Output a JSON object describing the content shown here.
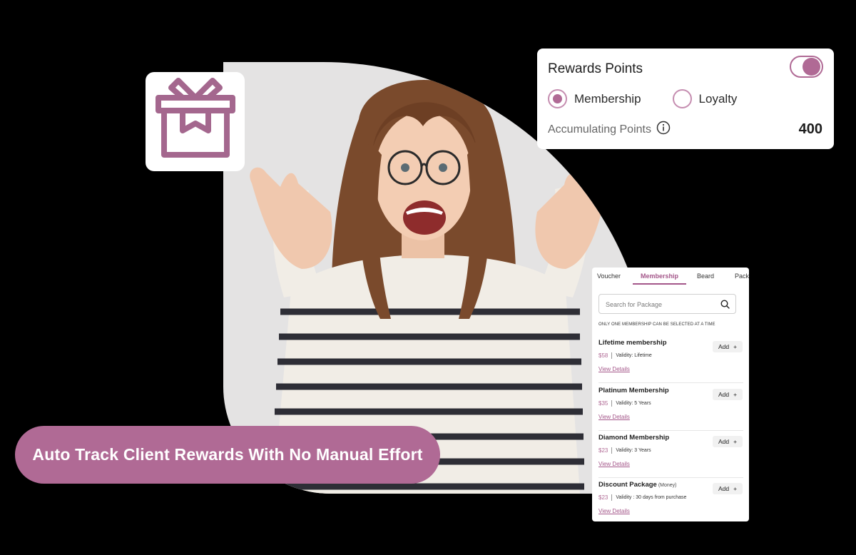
{
  "rewards": {
    "title": "Rewards Points",
    "toggle_on": true,
    "options": [
      {
        "label": "Membership",
        "selected": true
      },
      {
        "label": "Loyalty",
        "selected": false
      }
    ],
    "accumulating_label": "Accumulating Points",
    "points": "400"
  },
  "panel": {
    "tabs": [
      "Voucher",
      "Membership",
      "Beard",
      "Pack"
    ],
    "active_tab": "Membership",
    "search_placeholder": "Search for Package",
    "notice": "ONLY ONE MEMBERSHIP CAN BE SELECTED AT A TIME",
    "items": [
      {
        "name": "Lifetime membership",
        "note": "",
        "price": "$58",
        "validity": "Validity: Lifetime",
        "view": "View Details",
        "add": "Add"
      },
      {
        "name": "Platinum Membership",
        "note": "",
        "price": "$35",
        "validity": "Validity: 5 Years",
        "view": "View Details",
        "add": "Add"
      },
      {
        "name": "Diamond Membership",
        "note": "",
        "price": "$23",
        "validity": "Validity: 3 Years",
        "view": "View Details",
        "add": "Add"
      },
      {
        "name": "Discount Package",
        "note": "(Money)",
        "price": "$23",
        "validity": "Validity : 30 days from purchase",
        "view": "View Details",
        "add": "Add"
      }
    ]
  },
  "banner": {
    "text": "Auto Track Client Rewards With No Manual Effort"
  },
  "colors": {
    "accent": "#b06a95",
    "background": "#000000",
    "photo_backdrop": "#e4e3e3"
  },
  "icons": {
    "gift": "gift-icon",
    "info": "info-icon",
    "search": "search-icon",
    "plus": "plus-icon"
  }
}
